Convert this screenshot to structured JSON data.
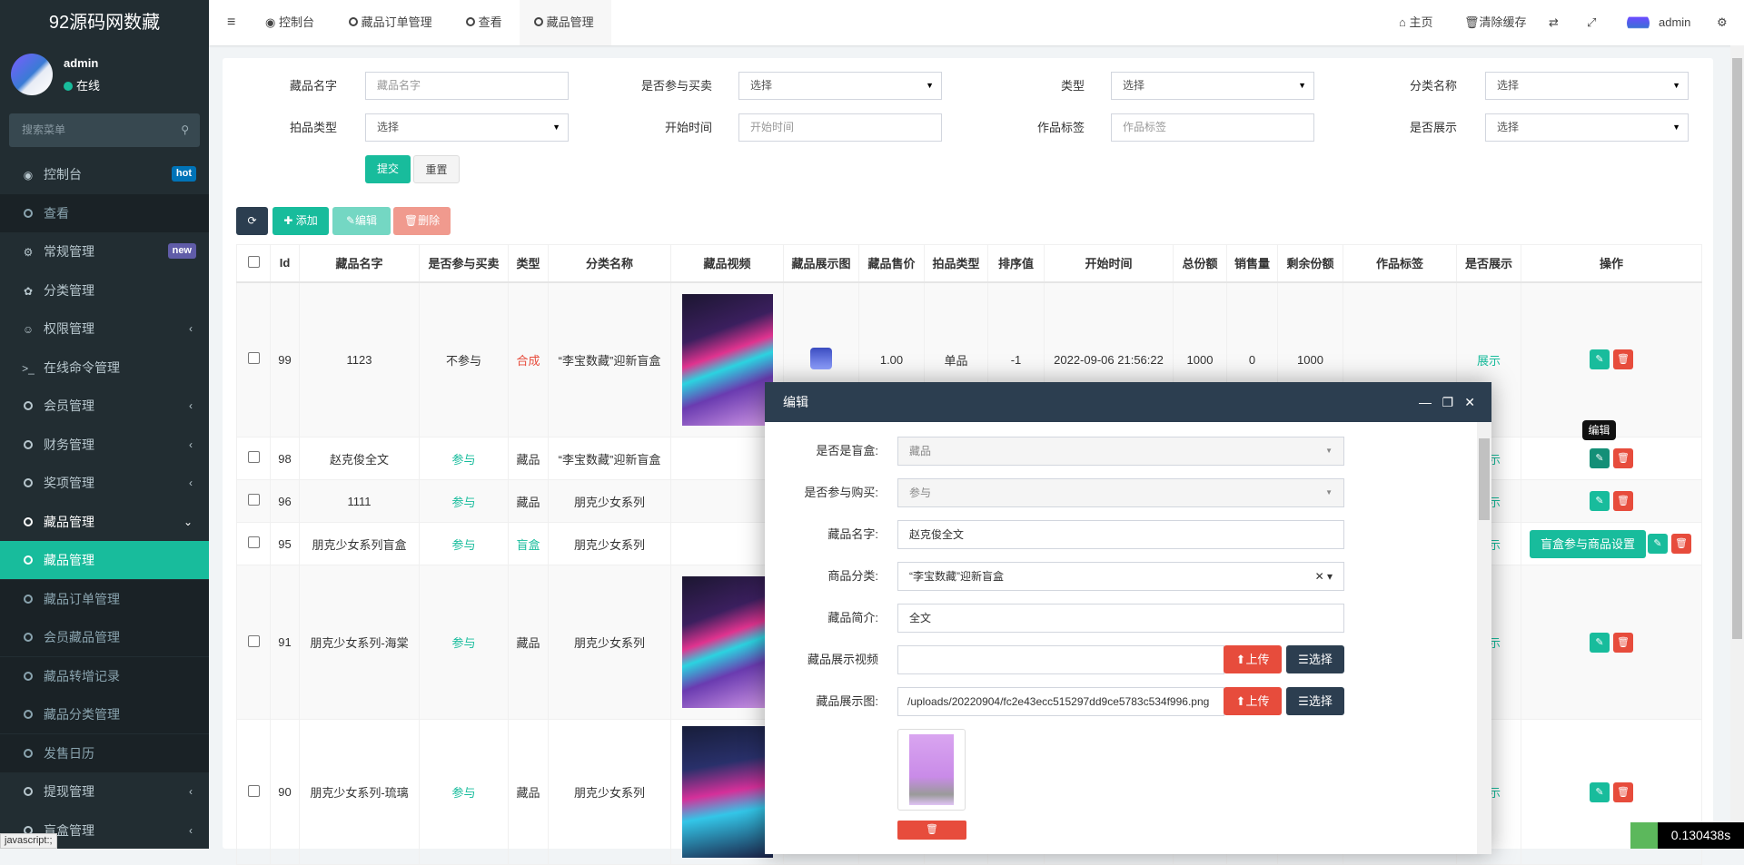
{
  "app": {
    "logo": "92源码网数藏"
  },
  "user": {
    "name": "admin",
    "status": "在线"
  },
  "sidebar": {
    "search_placeholder": "搜索菜单",
    "items": [
      {
        "label": "控制台",
        "badge": "hot",
        "badge_color": "#0073b7"
      },
      {
        "label": "查看"
      },
      {
        "label": "常规管理",
        "badge": "new",
        "badge_color": "#605ca8"
      },
      {
        "label": "分类管理"
      },
      {
        "label": "权限管理"
      },
      {
        "label": "在线命令管理"
      },
      {
        "label": "会员管理"
      },
      {
        "label": "财务管理"
      },
      {
        "label": "奖项管理"
      },
      {
        "label": "藏品管理"
      },
      {
        "label": "藏品管理"
      },
      {
        "label": "藏品订单管理"
      },
      {
        "label": "会员藏品管理"
      },
      {
        "label": "藏品转增记录"
      },
      {
        "label": "藏品分类管理"
      },
      {
        "label": "发售日历"
      },
      {
        "label": "提现管理"
      },
      {
        "label": "盲盒管理"
      }
    ]
  },
  "header": {
    "tabs": [
      "控制台",
      "藏品订单管理",
      "查看",
      "藏品管理"
    ],
    "home": "主页",
    "clear_cache": "清除缓存",
    "username": "admin"
  },
  "filters": {
    "name_label": "藏品名字",
    "name_placeholder": "藏品名字",
    "trade_label": "是否参与买卖",
    "trade_value": "选择",
    "type_label": "类型",
    "type_value": "选择",
    "category_label": "分类名称",
    "category_value": "选择",
    "auction_label": "拍品类型",
    "auction_value": "选择",
    "start_label": "开始时间",
    "start_placeholder": "开始时间",
    "tag_label": "作品标签",
    "tag_placeholder": "作品标签",
    "show_label": "是否展示",
    "show_value": "选择",
    "submit": "提交",
    "reset": "重置"
  },
  "toolbar": {
    "add": "添加",
    "edit": "编辑",
    "delete": "删除"
  },
  "table": {
    "headers": [
      "Id",
      "藏品名字",
      "是否参与买卖",
      "类型",
      "分类名称",
      "藏品视频",
      "藏品展示图",
      "藏品售价",
      "拍品类型",
      "排序值",
      "开始时间",
      "总份额",
      "销售量",
      "剩余份额",
      "作品标签",
      "是否展示",
      "操作"
    ],
    "rows": [
      {
        "id": "99",
        "name": "1123",
        "trade": "不参与",
        "type": "合成",
        "category": "“李宝数藏”迎新盲盒",
        "video": true,
        "image": true,
        "price": "1.00",
        "auction": "单品",
        "sort": "-1",
        "start": "2022-09-06 21:56:22",
        "total": "1000",
        "sold": "0",
        "remaining": "1000",
        "tag": "",
        "show": "展示"
      },
      {
        "id": "98",
        "name": "赵克俊全文",
        "trade": "参与",
        "type": "藏品",
        "category": "“李宝数藏”迎新盲盒",
        "show": "展示"
      },
      {
        "id": "96",
        "name": "1111",
        "trade": "参与",
        "type": "藏品",
        "category": "朋克少女系列",
        "show": "展示"
      },
      {
        "id": "95",
        "name": "朋克少女系列盲盒",
        "trade": "参与",
        "type": "盲盒",
        "category": "朋克少女系列",
        "show": "展示",
        "extra": "盲盒参与商品设置"
      },
      {
        "id": "91",
        "name": "朋克少女系列-海棠",
        "trade": "参与",
        "type": "藏品",
        "category": "朋克少女系列",
        "video": true,
        "show": "展示"
      },
      {
        "id": "90",
        "name": "朋克少女系列-琉璃",
        "trade": "参与",
        "type": "藏品",
        "category": "朋克少女系列",
        "video": true,
        "show": "展示"
      }
    ]
  },
  "tooltip": "编辑",
  "modal": {
    "title": "编辑",
    "blind_label": "是否是盲盒:",
    "blind_value": "藏品",
    "buy_label": "是否参与购买:",
    "buy_value": "参与",
    "name_label": "藏品名字:",
    "name_value": "赵克俊全文",
    "cat_label": "商品分类:",
    "cat_value": "“李宝数藏”迎新盲盒",
    "intro_label": "藏品简介:",
    "intro_value": "全文",
    "video_label": "藏品展示视频",
    "video_value": "",
    "image_label": "藏品展示图:",
    "image_value": "/uploads/20220904/fc2e43ecc515297dd9ce5783c534f996.png",
    "upload": "上传",
    "choose": "选择"
  },
  "status": {
    "link": "javascript:;",
    "timing": "0.130438s"
  }
}
